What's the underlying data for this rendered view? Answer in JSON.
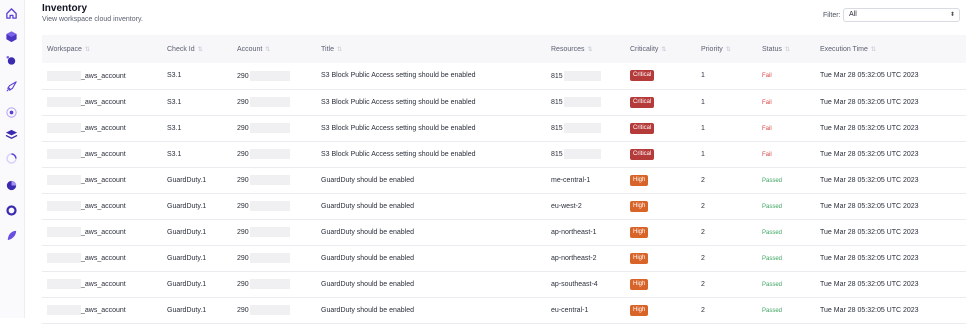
{
  "colors": {
    "accent": "#5b3fd6",
    "critical": "#b53a3a",
    "high": "#d9642a",
    "fail": "#d64545",
    "passed": "#3da45f"
  },
  "sidebar": {
    "icons": [
      "home-icon",
      "cube-icon",
      "orbit-icon",
      "rocket-icon",
      "target-icon",
      "stack-icon",
      "spinner-icon",
      "pie-icon",
      "ring-icon",
      "feather-icon"
    ]
  },
  "header": {
    "title": "Inventory",
    "subtitle": "View workspace cloud inventory."
  },
  "filter": {
    "label": "Filter:",
    "value": "All"
  },
  "table": {
    "columns": [
      "Workspace",
      "Check Id",
      "Account",
      "Title",
      "Resources",
      "Criticality",
      "Priority",
      "Status",
      "Execution Time"
    ],
    "rows": [
      {
        "workspace": "_aws_account",
        "check_id": "S3.1",
        "account": "290",
        "title": "S3 Block Public Access setting should be enabled",
        "resources": "815",
        "criticality": "Critical",
        "priority": "1",
        "status": "Fail",
        "time": "Tue Mar 28 05:32:05 UTC 2023"
      },
      {
        "workspace": "_aws_account",
        "check_id": "S3.1",
        "account": "290",
        "title": "S3 Block Public Access setting should be enabled",
        "resources": "815",
        "criticality": "Critical",
        "priority": "1",
        "status": "Fail",
        "time": "Tue Mar 28 05:32:05 UTC 2023"
      },
      {
        "workspace": "_aws_account",
        "check_id": "S3.1",
        "account": "290",
        "title": "S3 Block Public Access setting should be enabled",
        "resources": "815",
        "criticality": "Critical",
        "priority": "1",
        "status": "Fail",
        "time": "Tue Mar 28 05:32:05 UTC 2023"
      },
      {
        "workspace": "_aws_account",
        "check_id": "S3.1",
        "account": "290",
        "title": "S3 Block Public Access setting should be enabled",
        "resources": "815",
        "criticality": "Critical",
        "priority": "1",
        "status": "Fail",
        "time": "Tue Mar 28 05:32:05 UTC 2023"
      },
      {
        "workspace": "_aws_account",
        "check_id": "GuardDuty.1",
        "account": "290",
        "title": "GuardDuty should be enabled",
        "resources": "me-central-1",
        "criticality": "High",
        "priority": "2",
        "status": "Passed",
        "time": "Tue Mar 28 05:32:05 UTC 2023"
      },
      {
        "workspace": "_aws_account",
        "check_id": "GuardDuty.1",
        "account": "290",
        "title": "GuardDuty should be enabled",
        "resources": "eu-west-2",
        "criticality": "High",
        "priority": "2",
        "status": "Passed",
        "time": "Tue Mar 28 05:32:05 UTC 2023"
      },
      {
        "workspace": "_aws_account",
        "check_id": "GuardDuty.1",
        "account": "290",
        "title": "GuardDuty should be enabled",
        "resources": "ap-northeast-1",
        "criticality": "High",
        "priority": "2",
        "status": "Passed",
        "time": "Tue Mar 28 05:32:05 UTC 2023"
      },
      {
        "workspace": "_aws_account",
        "check_id": "GuardDuty.1",
        "account": "290",
        "title": "GuardDuty should be enabled",
        "resources": "ap-northeast-2",
        "criticality": "High",
        "priority": "2",
        "status": "Passed",
        "time": "Tue Mar 28 05:32:05 UTC 2023"
      },
      {
        "workspace": "_aws_account",
        "check_id": "GuardDuty.1",
        "account": "290",
        "title": "GuardDuty should be enabled",
        "resources": "ap-southeast-4",
        "criticality": "High",
        "priority": "2",
        "status": "Passed",
        "time": "Tue Mar 28 05:32:05 UTC 2023"
      },
      {
        "workspace": "_aws_account",
        "check_id": "GuardDuty.1",
        "account": "290",
        "title": "GuardDuty should be enabled",
        "resources": "eu-central-1",
        "criticality": "High",
        "priority": "2",
        "status": "Passed",
        "time": "Tue Mar 28 05:32:05 UTC 2023"
      }
    ]
  }
}
